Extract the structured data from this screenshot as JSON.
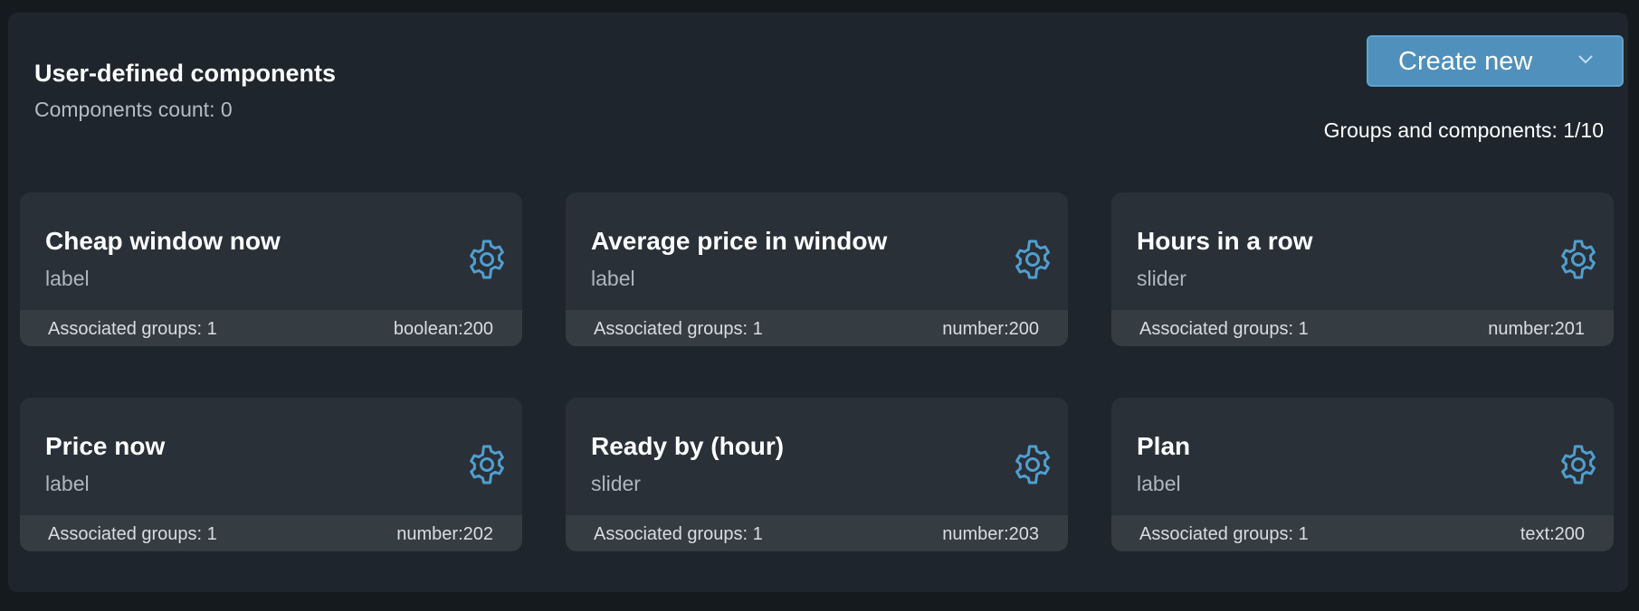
{
  "header": {
    "title": "User-defined components",
    "count_text": "Components count: 0",
    "create_label": "Create new",
    "groups_text": "Groups and components: 1/10"
  },
  "colors": {
    "accent": "#4f90bc",
    "gear": "#4f9fd0",
    "panel": "#1f252c",
    "card": "#2a3038"
  },
  "cards": [
    {
      "name": "Cheap window now",
      "kind": "label",
      "assoc": "Associated groups: 1",
      "type": "boolean:200",
      "icon": "gear-icon"
    },
    {
      "name": "Average price in window",
      "kind": "label",
      "assoc": "Associated groups: 1",
      "type": "number:200",
      "icon": "gear-icon"
    },
    {
      "name": "Hours in a row",
      "kind": "slider",
      "assoc": "Associated groups: 1",
      "type": "number:201",
      "icon": "gear-icon"
    },
    {
      "name": "Price now",
      "kind": "label",
      "assoc": "Associated groups: 1",
      "type": "number:202",
      "icon": "gear-icon"
    },
    {
      "name": "Ready by (hour)",
      "kind": "slider",
      "assoc": "Associated groups: 1",
      "type": "number:203",
      "icon": "gear-icon"
    },
    {
      "name": "Plan",
      "kind": "label",
      "assoc": "Associated groups: 1",
      "type": "text:200",
      "icon": "gear-icon"
    }
  ]
}
